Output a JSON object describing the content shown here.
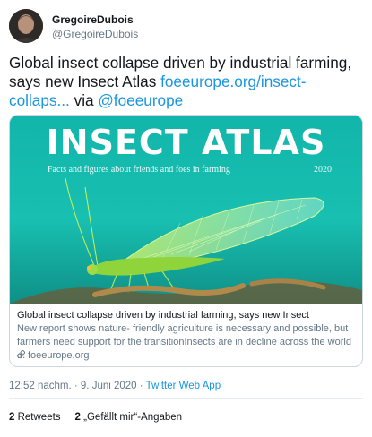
{
  "author": {
    "display_name": "GregoireDubois",
    "handle": "@GregoireDubois"
  },
  "tweet": {
    "text_before": "Global insect collapse driven by industrial farming, says new Insect Atlas ",
    "link_text": "foeeurope.org/insect-collaps...",
    "text_middle": " via ",
    "mention": "@foeeurope"
  },
  "card": {
    "image_title": "INSECT ATLAS",
    "image_subtitle": "Facts and figures about friends and foes in farming",
    "image_year": "2020",
    "title": "Global insect collapse driven by industrial farming, says new Insect",
    "description": "New report shows nature- friendly agriculture is necessary and possible, but farmers need support for the transitionInsects are in decline across the world ...",
    "domain": "foeeurope.org",
    "domain_icon": "link-icon"
  },
  "meta": {
    "timestamp": "12:52 nachm. · 9. Juni 2020 · ",
    "client": "Twitter Web App"
  },
  "stats": {
    "retweets_count": "2",
    "retweets_label": " Retweets",
    "likes_count": "2",
    "likes_label": " „Gefällt mir“-Angaben"
  },
  "colors": {
    "link": "#1b95e0",
    "secondary_text": "#657786",
    "card_border": "#ccd6dd",
    "image_background": "#12b5aa"
  }
}
